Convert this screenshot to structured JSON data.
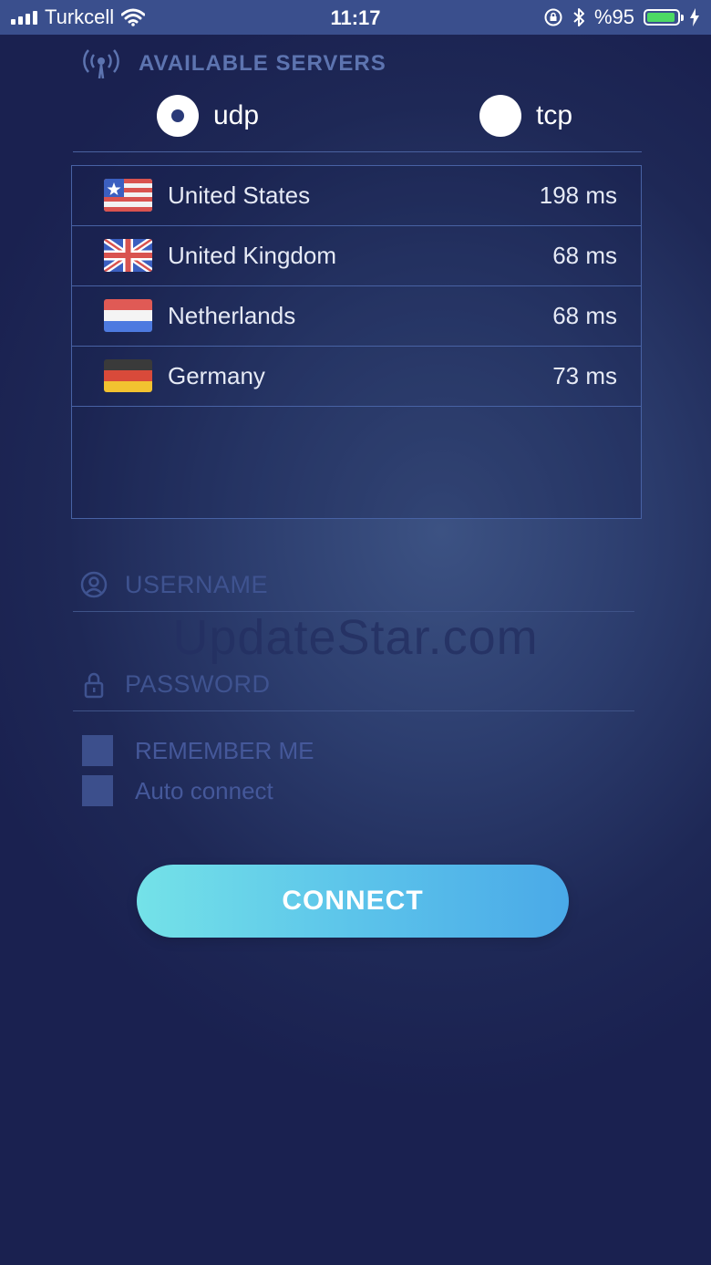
{
  "status_bar": {
    "carrier": "Turkcell",
    "time": "11:17",
    "battery_percent": "%95",
    "battery_level": 0.95,
    "icons": [
      "signal-icon",
      "wifi-icon",
      "rotation-lock-icon",
      "bluetooth-icon",
      "battery-icon",
      "charging-icon"
    ]
  },
  "header": {
    "title": "AVAILABLE SERVERS",
    "icon": "antenna-icon"
  },
  "protocols": [
    {
      "label": "udp",
      "selected": true
    },
    {
      "label": "tcp",
      "selected": false
    }
  ],
  "servers": [
    {
      "name": "United States",
      "ping": "198 ms",
      "flag": "us-flag-icon"
    },
    {
      "name": "United Kingdom",
      "ping": "68 ms",
      "flag": "uk-flag-icon"
    },
    {
      "name": "Netherlands",
      "ping": "68 ms",
      "flag": "nl-flag-icon"
    },
    {
      "name": "Germany",
      "ping": "73 ms",
      "flag": "de-flag-icon"
    }
  ],
  "form": {
    "username_placeholder": "USERNAME",
    "username_value": "",
    "password_placeholder": "PASSWORD",
    "password_value": "",
    "remember_label": "REMEMBER ME",
    "remember_checked": false,
    "auto_connect_label": "Auto connect",
    "auto_connect_checked": false
  },
  "watermark": "UpdateStar.com",
  "connect_label": "CONNECT",
  "colors": {
    "status_bar": "#3a4f8d",
    "background": "#1e2856",
    "accent_start": "#74e2e8",
    "accent_end": "#4aa9e8",
    "battery": "#4cd964"
  }
}
